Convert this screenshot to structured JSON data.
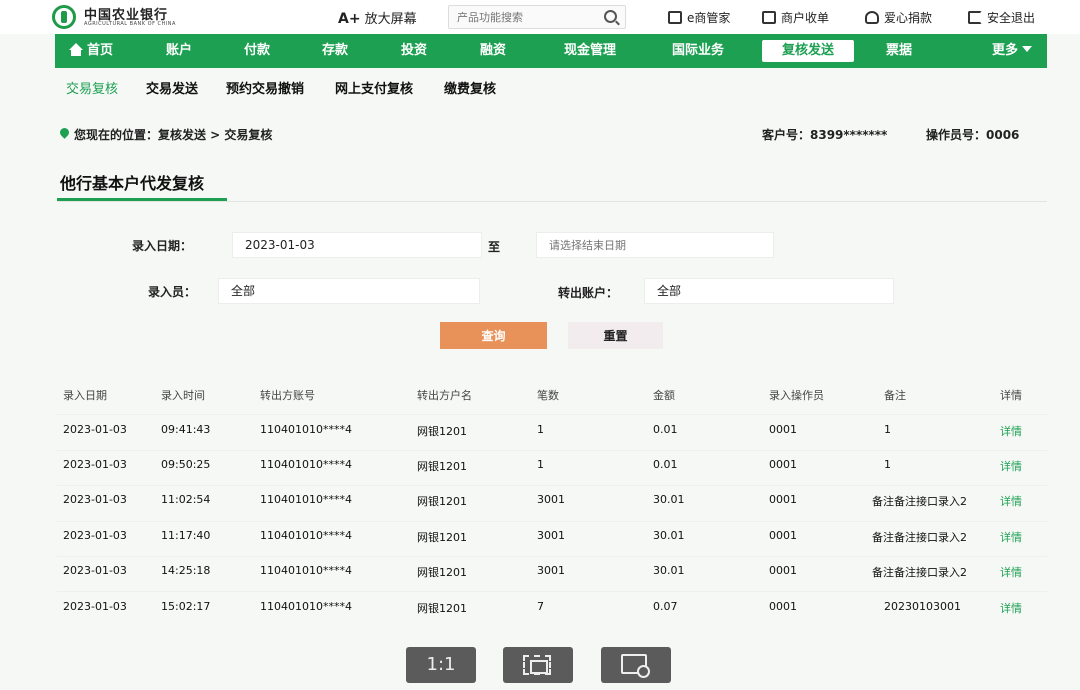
{
  "header": {
    "logo_cn": "中国农业银行",
    "logo_en": "AGRICULTURAL BANK OF CHINA",
    "zoom_toggle_prefix": "A+",
    "zoom_toggle_label": "放大屏幕",
    "search_placeholder": "产品功能搜索",
    "links": [
      "e商管家",
      "商户收单",
      "爱心捐款",
      "安全退出"
    ]
  },
  "nav": {
    "home": "首页",
    "items": [
      "账户",
      "付款",
      "存款",
      "投资",
      "融资",
      "现金管理",
      "国际业务",
      "复核发送",
      "票据"
    ],
    "active": "复核发送",
    "more": "更多"
  },
  "subnav": {
    "items": [
      "交易复核",
      "交易发送",
      "预约交易撤销",
      "网上支付复核",
      "缴费复核"
    ],
    "active": "交易复核"
  },
  "location": {
    "breadcrumb": "您现在的位置：复核发送 > 交易复核",
    "customer_no": "客户号：8399*******",
    "operator_no": "操作员号：0006"
  },
  "page": {
    "title": "他行基本户代发复核"
  },
  "form": {
    "entry_date_label": "录入日期：",
    "entry_date_start": "2023-01-03",
    "to_label": "至",
    "end_date_placeholder": "请选择结束日期",
    "entry_operator_label": "录入员：",
    "entry_operator_value": "全部",
    "out_account_label": "转出账户：",
    "out_account_value": "全部",
    "query_button": "查询",
    "reset_button": "重置"
  },
  "table": {
    "columns": [
      "录入日期",
      "录入时间",
      "转出方账号",
      "转出方户名",
      "笔数",
      "金额",
      "录入操作员",
      "备注",
      "详情"
    ],
    "rows": [
      {
        "date": "2023-01-03",
        "time": "09:41:43",
        "account": "110401010****4",
        "name": "网银1201",
        "count": "1",
        "amount": "0.01",
        "operator": "0001",
        "remark": "1",
        "detail": "详情"
      },
      {
        "date": "2023-01-03",
        "time": "09:50:25",
        "account": "110401010****4",
        "name": "网银1201",
        "count": "1",
        "amount": "0.01",
        "operator": "0001",
        "remark": "1",
        "detail": "详情"
      },
      {
        "date": "2023-01-03",
        "time": "11:02:54",
        "account": "110401010****4",
        "name": "网银1201",
        "count": "3001",
        "amount": "30.01",
        "operator": "0001",
        "remark": "备注备注接口录入2",
        "detail": "详情"
      },
      {
        "date": "2023-01-03",
        "time": "11:17:40",
        "account": "110401010****4",
        "name": "网银1201",
        "count": "3001",
        "amount": "30.01",
        "operator": "0001",
        "remark": "备注备注接口录入2",
        "detail": "详情"
      },
      {
        "date": "2023-01-03",
        "time": "14:25:18",
        "account": "110401010****4",
        "name": "网银1201",
        "count": "3001",
        "amount": "30.01",
        "operator": "0001",
        "remark": "备注备注接口录入2",
        "detail": "详情"
      },
      {
        "date": "2023-01-03",
        "time": "15:02:17",
        "account": "110401010****4",
        "name": "网银1201",
        "count": "7",
        "amount": "0.07",
        "operator": "0001",
        "remark": "20230103001",
        "detail": "详情"
      }
    ]
  },
  "overlay": {
    "actual_size_label": "1:1"
  },
  "colors": {
    "brand_green": "#1da052",
    "query_orange": "#e8925a"
  }
}
